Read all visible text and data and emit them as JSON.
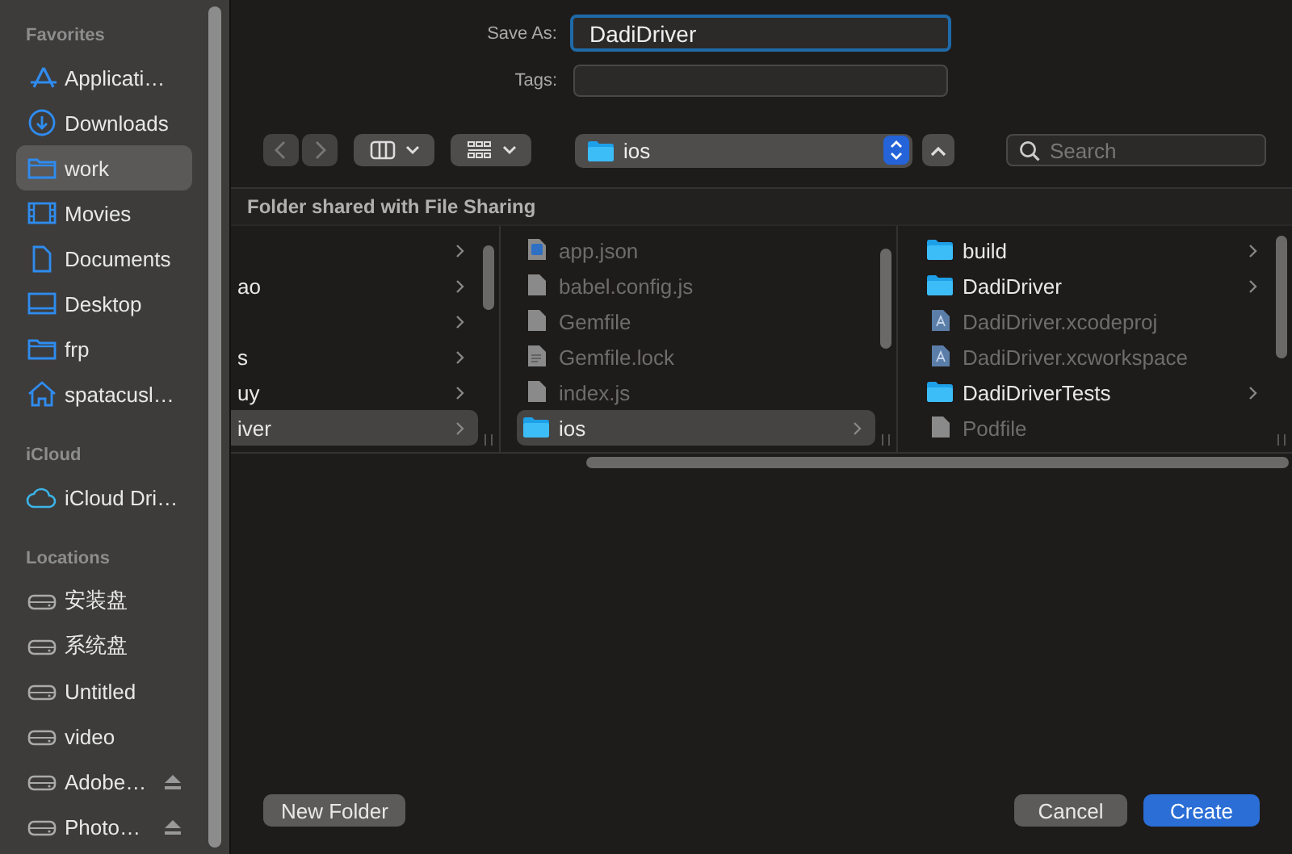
{
  "sidebar": {
    "sections": [
      {
        "title": "Favorites",
        "items": [
          {
            "label": "Applicati…",
            "kind": "apps",
            "selected": false
          },
          {
            "label": "Downloads",
            "kind": "download",
            "selected": false
          },
          {
            "label": "work",
            "kind": "folder",
            "selected": true
          },
          {
            "label": "Movies",
            "kind": "film",
            "selected": false
          },
          {
            "label": "Documents",
            "kind": "doc",
            "selected": false
          },
          {
            "label": "Desktop",
            "kind": "desktop",
            "selected": false
          },
          {
            "label": "frp",
            "kind": "folder",
            "selected": false
          },
          {
            "label": "spatacusl…",
            "kind": "home",
            "selected": false
          }
        ]
      },
      {
        "title": "iCloud",
        "items": [
          {
            "label": "iCloud Dri…",
            "kind": "cloud",
            "selected": false
          }
        ]
      },
      {
        "title": "Locations",
        "items": [
          {
            "label": "安装盘",
            "kind": "disk",
            "selected": false
          },
          {
            "label": "系统盘",
            "kind": "disk",
            "selected": false
          },
          {
            "label": "Untitled",
            "kind": "disk",
            "selected": false
          },
          {
            "label": "video",
            "kind": "disk",
            "selected": false
          },
          {
            "label": "Adobe…",
            "kind": "disk",
            "selected": false,
            "ejectable": true
          },
          {
            "label": "Photo…",
            "kind": "disk",
            "selected": false,
            "ejectable": true
          }
        ]
      }
    ]
  },
  "save_as": {
    "label": "Save As:",
    "value": "DadiDriver"
  },
  "tags": {
    "label": "Tags:"
  },
  "toolbar": {
    "location": "ios",
    "search": {
      "placeholder": "Search"
    }
  },
  "header": "Folder shared with File Sharing",
  "columns": [
    {
      "items": [
        {
          "kind": "folder",
          "selected": false
        },
        {
          "kind": "folder",
          "name": "ao",
          "selected": false
        },
        {
          "kind": "folder",
          "selected": false
        },
        {
          "kind": "folder",
          "name": "s",
          "selected": false
        },
        {
          "kind": "folder",
          "name": "uy",
          "selected": false
        },
        {
          "kind": "folder",
          "name": "iver",
          "selected": true
        }
      ]
    },
    {
      "items": [
        {
          "kind": "json",
          "name": "app.json",
          "selected": false,
          "enabled": false
        },
        {
          "kind": "file",
          "name": "babel.config.js",
          "selected": false,
          "enabled": false
        },
        {
          "kind": "file",
          "name": "Gemfile",
          "selected": false,
          "enabled": false
        },
        {
          "kind": "text",
          "name": "Gemfile.lock",
          "selected": false,
          "enabled": false
        },
        {
          "kind": "file",
          "name": "index.js",
          "selected": false,
          "enabled": false
        },
        {
          "kind": "folder",
          "name": "ios",
          "selected": true,
          "enabled": true
        }
      ]
    },
    {
      "items": [
        {
          "kind": "folder",
          "name": "build",
          "selected": false,
          "enabled": true
        },
        {
          "kind": "folder",
          "name": "DadiDriver",
          "selected": false,
          "enabled": true
        },
        {
          "kind": "xcode",
          "name": "DadiDriver.xcodeproj",
          "selected": false,
          "enabled": false
        },
        {
          "kind": "xcode",
          "name": "DadiDriver.xcworkspace",
          "selected": false,
          "enabled": false
        },
        {
          "kind": "folder",
          "name": "DadiDriverTests",
          "selected": false,
          "enabled": true
        },
        {
          "kind": "file",
          "name": "Podfile",
          "selected": false,
          "enabled": false
        }
      ]
    }
  ],
  "buttons": [
    {
      "label": "New Folder",
      "kind": "plain"
    },
    {
      "label": "Cancel",
      "kind": "plain"
    },
    {
      "label": "Create",
      "kind": "default"
    }
  ]
}
